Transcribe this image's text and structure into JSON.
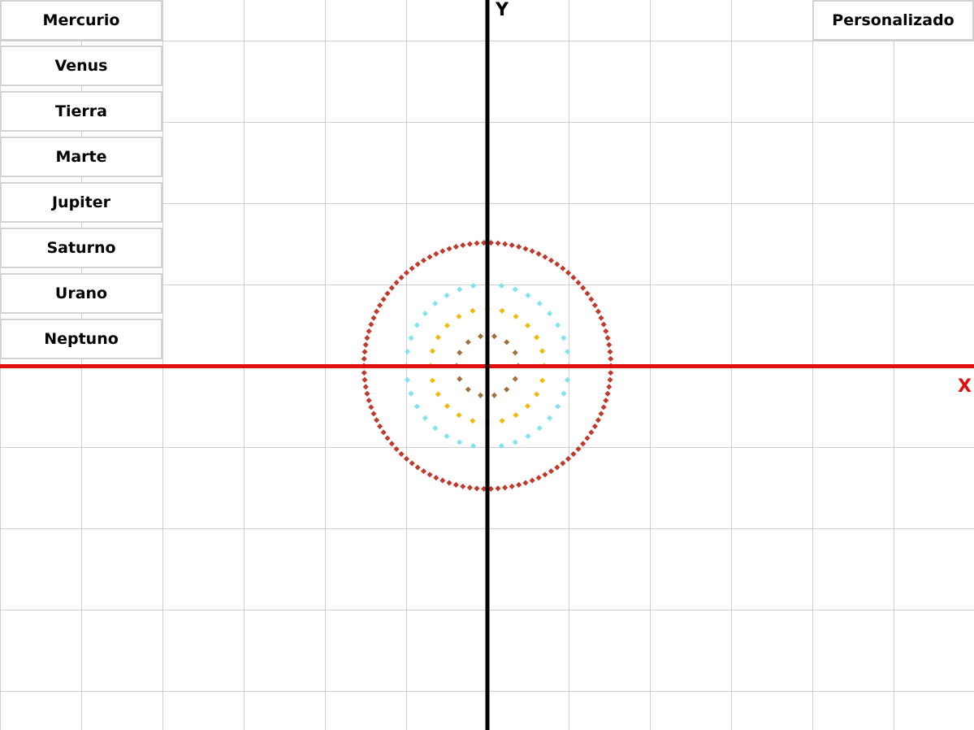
{
  "menu": {
    "planets": [
      {
        "label": "Mercurio"
      },
      {
        "label": "Venus"
      },
      {
        "label": "Tierra"
      },
      {
        "label": "Marte"
      },
      {
        "label": "Jupiter"
      },
      {
        "label": "Saturno"
      },
      {
        "label": "Urano"
      },
      {
        "label": "Neptuno"
      }
    ],
    "custom_label": "Personalizado"
  },
  "axes": {
    "x_label": "X",
    "y_label": "Y",
    "x_axis_color": "#e11010",
    "y_axis_color": "#000000",
    "grid_color": "#cfcfcf"
  },
  "orbits": [
    {
      "semi_major": 0.38,
      "eccentricity": 0.2,
      "color": "#a0703a",
      "points": 14
    },
    {
      "semi_major": 0.7,
      "eccentricity": 0.0,
      "color": "#f2b90c",
      "points": 24
    },
    {
      "semi_major": 1.0,
      "eccentricity": 0.0,
      "color": "#7fe3f2",
      "points": 36
    },
    {
      "semi_major": 1.52,
      "eccentricity": 0.09,
      "color": "#c0392b",
      "points": 110
    }
  ]
}
